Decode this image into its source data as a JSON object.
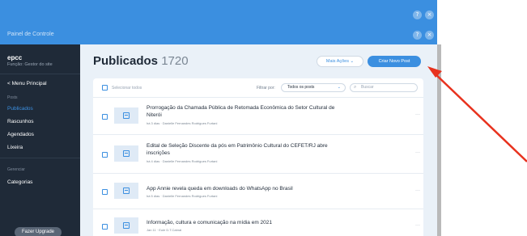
{
  "window": {
    "app_title": "Painel de Controle",
    "help_glyph": "?",
    "close_glyph": "×",
    "bar_color": "#3b8fe0"
  },
  "sidebar": {
    "site_name": "epcc",
    "role": "Função: Gestor do site",
    "back_label": "< Menu Principal",
    "section_posts": "Posts",
    "items": [
      {
        "label": "Publicados",
        "active": true
      },
      {
        "label": "Rascunhos",
        "active": false
      },
      {
        "label": "Agendados",
        "active": false
      },
      {
        "label": "Lixeira",
        "active": false
      }
    ],
    "section_manage": "Gerenciar",
    "categories_label": "Categorias",
    "upgrade_label": "Fazer Upgrade"
  },
  "main": {
    "heading": "Publicados",
    "count": "1720",
    "more_actions_label": "Mais Ações",
    "create_post_label": "Criar Novo Post",
    "select_all_label": "Selecionar todos",
    "filter_label": "Filtrar por:",
    "filter_value": "Todos os posts",
    "search_placeholder": "Buscar",
    "row_menu_glyph": "···",
    "posts": [
      {
        "title": "Prorrogação da Chamada Pública de Retomada Econômica do Setor Cultural de Niterói",
        "meta": "há 3 dias · Danielle Fernandes Rodrigues Furtani"
      },
      {
        "title": "Edital de Seleção Discente da pós em Patrimônio Cultural do CEFET/RJ abre inscrições",
        "meta": "há 4 dias · Danielle Fernandes Rodrigues Furtani"
      },
      {
        "title": "App Annie revela queda em downloads do WhatsApp no Brasil",
        "meta": "há 5 dias · Danielle Fernandes Rodrigues Furtani"
      },
      {
        "title": "Informação, cultura e comunicação na mídia em 2021",
        "meta": "Jan 11 · Eule D.T.Cabral"
      }
    ]
  },
  "annotation": {
    "arrow_color": "#e8321e"
  }
}
